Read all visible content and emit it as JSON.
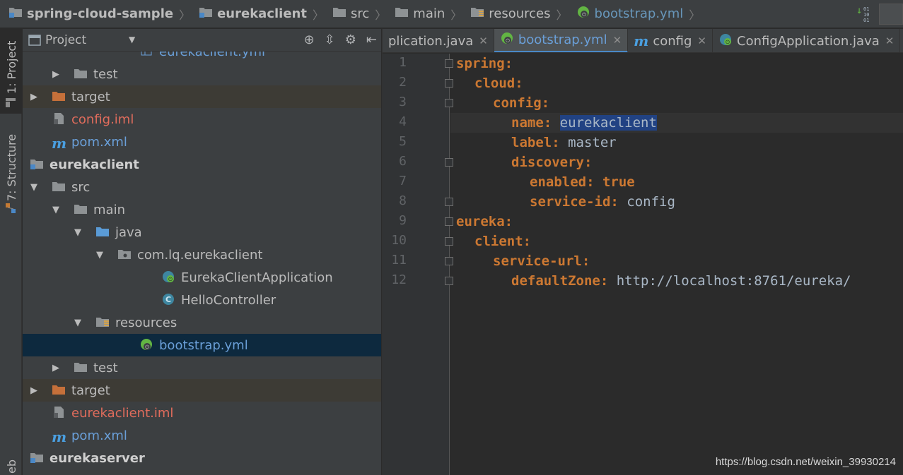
{
  "breadcrumb": {
    "items": [
      "spring-cloud-sample",
      "eurekaclient",
      "src",
      "main",
      "resources",
      "bootstrap.yml"
    ]
  },
  "vcs_bits": "01\n10\n01",
  "toolstrip": {
    "project_tab": "1: Project",
    "structure_tab": "7: Structure",
    "web_tab": "eb"
  },
  "project_panel": {
    "title": "Project",
    "tree": [
      {
        "label": "eurekaclient.yml",
        "depth": 6,
        "kind": "file-yml-partial"
      },
      {
        "label": "test",
        "depth": 3,
        "kind": "folder",
        "arrow": "right"
      },
      {
        "label": "target",
        "depth": 2,
        "kind": "folder-orange",
        "arrow": "right",
        "excluded": true
      },
      {
        "label": "config.iml",
        "depth": 2,
        "kind": "iml"
      },
      {
        "label": "pom.xml",
        "depth": 2,
        "kind": "maven"
      },
      {
        "label": "eurekaclient",
        "depth": 1,
        "kind": "module",
        "arrow": "down"
      },
      {
        "label": "src",
        "depth": 2,
        "kind": "folder",
        "arrow": "down"
      },
      {
        "label": "main",
        "depth": 3,
        "kind": "folder",
        "arrow": "down"
      },
      {
        "label": "java",
        "depth": 4,
        "kind": "folder-blue",
        "arrow": "down"
      },
      {
        "label": "com.lq.eurekaclient",
        "depth": 5,
        "kind": "package",
        "arrow": "down"
      },
      {
        "label": "EurekaClientApplication",
        "depth": 7,
        "kind": "spring-class"
      },
      {
        "label": "HelloController",
        "depth": 7,
        "kind": "class"
      },
      {
        "label": "resources",
        "depth": 4,
        "kind": "folder-res",
        "arrow": "down"
      },
      {
        "label": "bootstrap.yml",
        "depth": 6,
        "kind": "spring-yml",
        "selected": true
      },
      {
        "label": "test",
        "depth": 3,
        "kind": "folder",
        "arrow": "right"
      },
      {
        "label": "target",
        "depth": 2,
        "kind": "folder-orange",
        "arrow": "right",
        "excluded": true
      },
      {
        "label": "eurekaclient.iml",
        "depth": 2,
        "kind": "iml"
      },
      {
        "label": "pom.xml",
        "depth": 2,
        "kind": "maven"
      },
      {
        "label": "eurekaserver",
        "depth": 1,
        "kind": "module",
        "arrow": "right"
      }
    ]
  },
  "editor": {
    "tabs": [
      {
        "label": "plication.java",
        "kind": "none"
      },
      {
        "label": "bootstrap.yml",
        "kind": "spring-yml",
        "active": true
      },
      {
        "label": "config",
        "kind": "maven"
      },
      {
        "label": "ConfigApplication.java",
        "kind": "spring-class"
      }
    ],
    "lines": [
      {
        "n": "1",
        "indent": 0,
        "key": "spring:",
        "val": ""
      },
      {
        "n": "2",
        "indent": 1,
        "key": "cloud:",
        "val": ""
      },
      {
        "n": "3",
        "indent": 2,
        "key": "config:",
        "val": ""
      },
      {
        "n": "4",
        "indent": 3,
        "key": "name:",
        "val": "eurekaclient",
        "highlight": true
      },
      {
        "n": "5",
        "indent": 3,
        "key": "label:",
        "val": "master"
      },
      {
        "n": "6",
        "indent": 3,
        "key": "discovery:",
        "val": ""
      },
      {
        "n": "7",
        "indent": 4,
        "key": "enabled:",
        "val": "true",
        "valKeyword": true
      },
      {
        "n": "8",
        "indent": 4,
        "key": "service-id:",
        "val": "config"
      },
      {
        "n": "9",
        "indent": 0,
        "key": "eureka:",
        "val": ""
      },
      {
        "n": "10",
        "indent": 1,
        "key": "client:",
        "val": ""
      },
      {
        "n": "11",
        "indent": 2,
        "key": "service-url:",
        "val": ""
      },
      {
        "n": "12",
        "indent": 3,
        "key": "defaultZone:",
        "val": "http://localhost:8761/eureka/"
      }
    ]
  },
  "watermark": "https://blog.csdn.net/weixin_39930214"
}
